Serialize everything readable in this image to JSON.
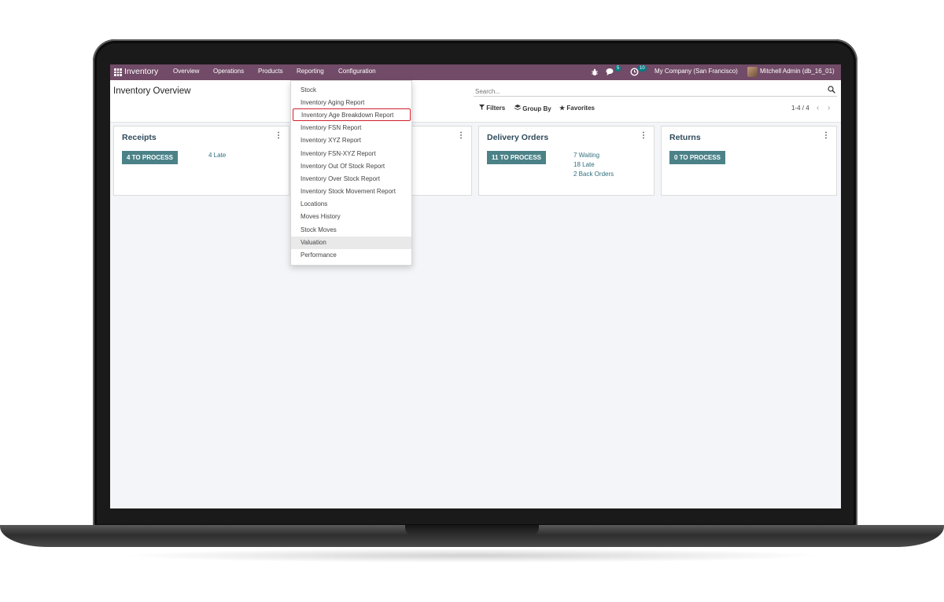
{
  "navbar": {
    "app_title": "Inventory",
    "menu": [
      "Overview",
      "Operations",
      "Products",
      "Reporting",
      "Configuration"
    ],
    "chat_count": "5",
    "activity_count": "10",
    "company": "My Company (San Francisco)",
    "user": "Mitchell Admin (db_16_01)"
  },
  "control_panel": {
    "title": "Inventory Overview",
    "search_placeholder": "Search...",
    "filters_label": "Filters",
    "group_by_label": "Group By",
    "favorites_label": "Favorites",
    "pager": "1-4 / 4"
  },
  "cards": [
    {
      "title": "Receipts",
      "button": "4 TO PROCESS",
      "links": [
        "4 Late"
      ]
    },
    {
      "title": "",
      "button": "",
      "links": []
    },
    {
      "title": "Delivery Orders",
      "button": "11 TO PROCESS",
      "links": [
        "7 Waiting",
        "18 Late",
        "2 Back Orders"
      ]
    },
    {
      "title": "Returns",
      "button": "0 TO PROCESS",
      "links": []
    }
  ],
  "reporting_menu": {
    "items": [
      "Stock",
      "Inventory Aging Report",
      "Inventory Age Breakdown Report",
      "Inventory FSN Report",
      "Inventory XYZ Report",
      "Inventory FSN-XYZ Report",
      "Inventory Out Of Stock Report",
      "Inventory Over Stock Report",
      "Inventory Stock Movement Report",
      "Locations",
      "Moves History",
      "Stock Moves",
      "Valuation",
      "Performance"
    ],
    "highlighted_item": "Inventory Age Breakdown Report",
    "hovered_item": "Valuation"
  },
  "colors": {
    "navbar": "#714b67",
    "button": "#4b8288",
    "link": "#2f6f7e",
    "highlight_border": "#d11f2c",
    "badge": "#017e84"
  }
}
